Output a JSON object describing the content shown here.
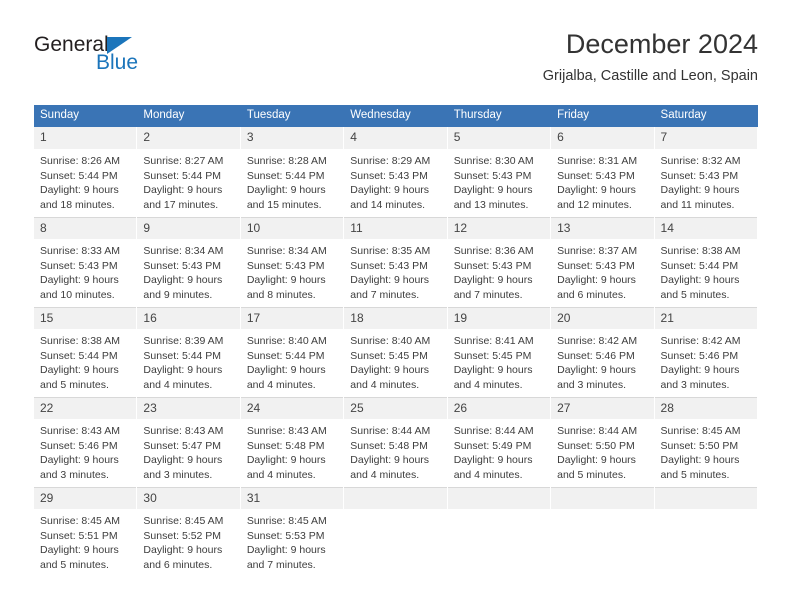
{
  "brand": {
    "name_top": "General",
    "name_bottom": "Blue",
    "triangle_color": "#1b75bb"
  },
  "header": {
    "title": "December 2024",
    "subtitle": "Grijalba, Castille and Leon, Spain"
  },
  "theme": {
    "header_bg": "#3a74b5",
    "header_text": "#ffffff",
    "daynum_bg": "#f1f1f1",
    "body_text": "#3d3d3d",
    "grid_line": "#d8d8d8"
  },
  "weekdays": [
    "Sunday",
    "Monday",
    "Tuesday",
    "Wednesday",
    "Thursday",
    "Friday",
    "Saturday"
  ],
  "weeks": [
    [
      {
        "day": "1",
        "sunrise": "Sunrise: 8:26 AM",
        "sunset": "Sunset: 5:44 PM",
        "daylight1": "Daylight: 9 hours",
        "daylight2": "and 18 minutes."
      },
      {
        "day": "2",
        "sunrise": "Sunrise: 8:27 AM",
        "sunset": "Sunset: 5:44 PM",
        "daylight1": "Daylight: 9 hours",
        "daylight2": "and 17 minutes."
      },
      {
        "day": "3",
        "sunrise": "Sunrise: 8:28 AM",
        "sunset": "Sunset: 5:44 PM",
        "daylight1": "Daylight: 9 hours",
        "daylight2": "and 15 minutes."
      },
      {
        "day": "4",
        "sunrise": "Sunrise: 8:29 AM",
        "sunset": "Sunset: 5:43 PM",
        "daylight1": "Daylight: 9 hours",
        "daylight2": "and 14 minutes."
      },
      {
        "day": "5",
        "sunrise": "Sunrise: 8:30 AM",
        "sunset": "Sunset: 5:43 PM",
        "daylight1": "Daylight: 9 hours",
        "daylight2": "and 13 minutes."
      },
      {
        "day": "6",
        "sunrise": "Sunrise: 8:31 AM",
        "sunset": "Sunset: 5:43 PM",
        "daylight1": "Daylight: 9 hours",
        "daylight2": "and 12 minutes."
      },
      {
        "day": "7",
        "sunrise": "Sunrise: 8:32 AM",
        "sunset": "Sunset: 5:43 PM",
        "daylight1": "Daylight: 9 hours",
        "daylight2": "and 11 minutes."
      }
    ],
    [
      {
        "day": "8",
        "sunrise": "Sunrise: 8:33 AM",
        "sunset": "Sunset: 5:43 PM",
        "daylight1": "Daylight: 9 hours",
        "daylight2": "and 10 minutes."
      },
      {
        "day": "9",
        "sunrise": "Sunrise: 8:34 AM",
        "sunset": "Sunset: 5:43 PM",
        "daylight1": "Daylight: 9 hours",
        "daylight2": "and 9 minutes."
      },
      {
        "day": "10",
        "sunrise": "Sunrise: 8:34 AM",
        "sunset": "Sunset: 5:43 PM",
        "daylight1": "Daylight: 9 hours",
        "daylight2": "and 8 minutes."
      },
      {
        "day": "11",
        "sunrise": "Sunrise: 8:35 AM",
        "sunset": "Sunset: 5:43 PM",
        "daylight1": "Daylight: 9 hours",
        "daylight2": "and 7 minutes."
      },
      {
        "day": "12",
        "sunrise": "Sunrise: 8:36 AM",
        "sunset": "Sunset: 5:43 PM",
        "daylight1": "Daylight: 9 hours",
        "daylight2": "and 7 minutes."
      },
      {
        "day": "13",
        "sunrise": "Sunrise: 8:37 AM",
        "sunset": "Sunset: 5:43 PM",
        "daylight1": "Daylight: 9 hours",
        "daylight2": "and 6 minutes."
      },
      {
        "day": "14",
        "sunrise": "Sunrise: 8:38 AM",
        "sunset": "Sunset: 5:44 PM",
        "daylight1": "Daylight: 9 hours",
        "daylight2": "and 5 minutes."
      }
    ],
    [
      {
        "day": "15",
        "sunrise": "Sunrise: 8:38 AM",
        "sunset": "Sunset: 5:44 PM",
        "daylight1": "Daylight: 9 hours",
        "daylight2": "and 5 minutes."
      },
      {
        "day": "16",
        "sunrise": "Sunrise: 8:39 AM",
        "sunset": "Sunset: 5:44 PM",
        "daylight1": "Daylight: 9 hours",
        "daylight2": "and 4 minutes."
      },
      {
        "day": "17",
        "sunrise": "Sunrise: 8:40 AM",
        "sunset": "Sunset: 5:44 PM",
        "daylight1": "Daylight: 9 hours",
        "daylight2": "and 4 minutes."
      },
      {
        "day": "18",
        "sunrise": "Sunrise: 8:40 AM",
        "sunset": "Sunset: 5:45 PM",
        "daylight1": "Daylight: 9 hours",
        "daylight2": "and 4 minutes."
      },
      {
        "day": "19",
        "sunrise": "Sunrise: 8:41 AM",
        "sunset": "Sunset: 5:45 PM",
        "daylight1": "Daylight: 9 hours",
        "daylight2": "and 4 minutes."
      },
      {
        "day": "20",
        "sunrise": "Sunrise: 8:42 AM",
        "sunset": "Sunset: 5:46 PM",
        "daylight1": "Daylight: 9 hours",
        "daylight2": "and 3 minutes."
      },
      {
        "day": "21",
        "sunrise": "Sunrise: 8:42 AM",
        "sunset": "Sunset: 5:46 PM",
        "daylight1": "Daylight: 9 hours",
        "daylight2": "and 3 minutes."
      }
    ],
    [
      {
        "day": "22",
        "sunrise": "Sunrise: 8:43 AM",
        "sunset": "Sunset: 5:46 PM",
        "daylight1": "Daylight: 9 hours",
        "daylight2": "and 3 minutes."
      },
      {
        "day": "23",
        "sunrise": "Sunrise: 8:43 AM",
        "sunset": "Sunset: 5:47 PM",
        "daylight1": "Daylight: 9 hours",
        "daylight2": "and 3 minutes."
      },
      {
        "day": "24",
        "sunrise": "Sunrise: 8:43 AM",
        "sunset": "Sunset: 5:48 PM",
        "daylight1": "Daylight: 9 hours",
        "daylight2": "and 4 minutes."
      },
      {
        "day": "25",
        "sunrise": "Sunrise: 8:44 AM",
        "sunset": "Sunset: 5:48 PM",
        "daylight1": "Daylight: 9 hours",
        "daylight2": "and 4 minutes."
      },
      {
        "day": "26",
        "sunrise": "Sunrise: 8:44 AM",
        "sunset": "Sunset: 5:49 PM",
        "daylight1": "Daylight: 9 hours",
        "daylight2": "and 4 minutes."
      },
      {
        "day": "27",
        "sunrise": "Sunrise: 8:44 AM",
        "sunset": "Sunset: 5:50 PM",
        "daylight1": "Daylight: 9 hours",
        "daylight2": "and 5 minutes."
      },
      {
        "day": "28",
        "sunrise": "Sunrise: 8:45 AM",
        "sunset": "Sunset: 5:50 PM",
        "daylight1": "Daylight: 9 hours",
        "daylight2": "and 5 minutes."
      }
    ],
    [
      {
        "day": "29",
        "sunrise": "Sunrise: 8:45 AM",
        "sunset": "Sunset: 5:51 PM",
        "daylight1": "Daylight: 9 hours",
        "daylight2": "and 5 minutes."
      },
      {
        "day": "30",
        "sunrise": "Sunrise: 8:45 AM",
        "sunset": "Sunset: 5:52 PM",
        "daylight1": "Daylight: 9 hours",
        "daylight2": "and 6 minutes."
      },
      {
        "day": "31",
        "sunrise": "Sunrise: 8:45 AM",
        "sunset": "Sunset: 5:53 PM",
        "daylight1": "Daylight: 9 hours",
        "daylight2": "and 7 minutes."
      },
      {
        "day": "",
        "sunrise": "",
        "sunset": "",
        "daylight1": "",
        "daylight2": ""
      },
      {
        "day": "",
        "sunrise": "",
        "sunset": "",
        "daylight1": "",
        "daylight2": ""
      },
      {
        "day": "",
        "sunrise": "",
        "sunset": "",
        "daylight1": "",
        "daylight2": ""
      },
      {
        "day": "",
        "sunrise": "",
        "sunset": "",
        "daylight1": "",
        "daylight2": ""
      }
    ]
  ]
}
